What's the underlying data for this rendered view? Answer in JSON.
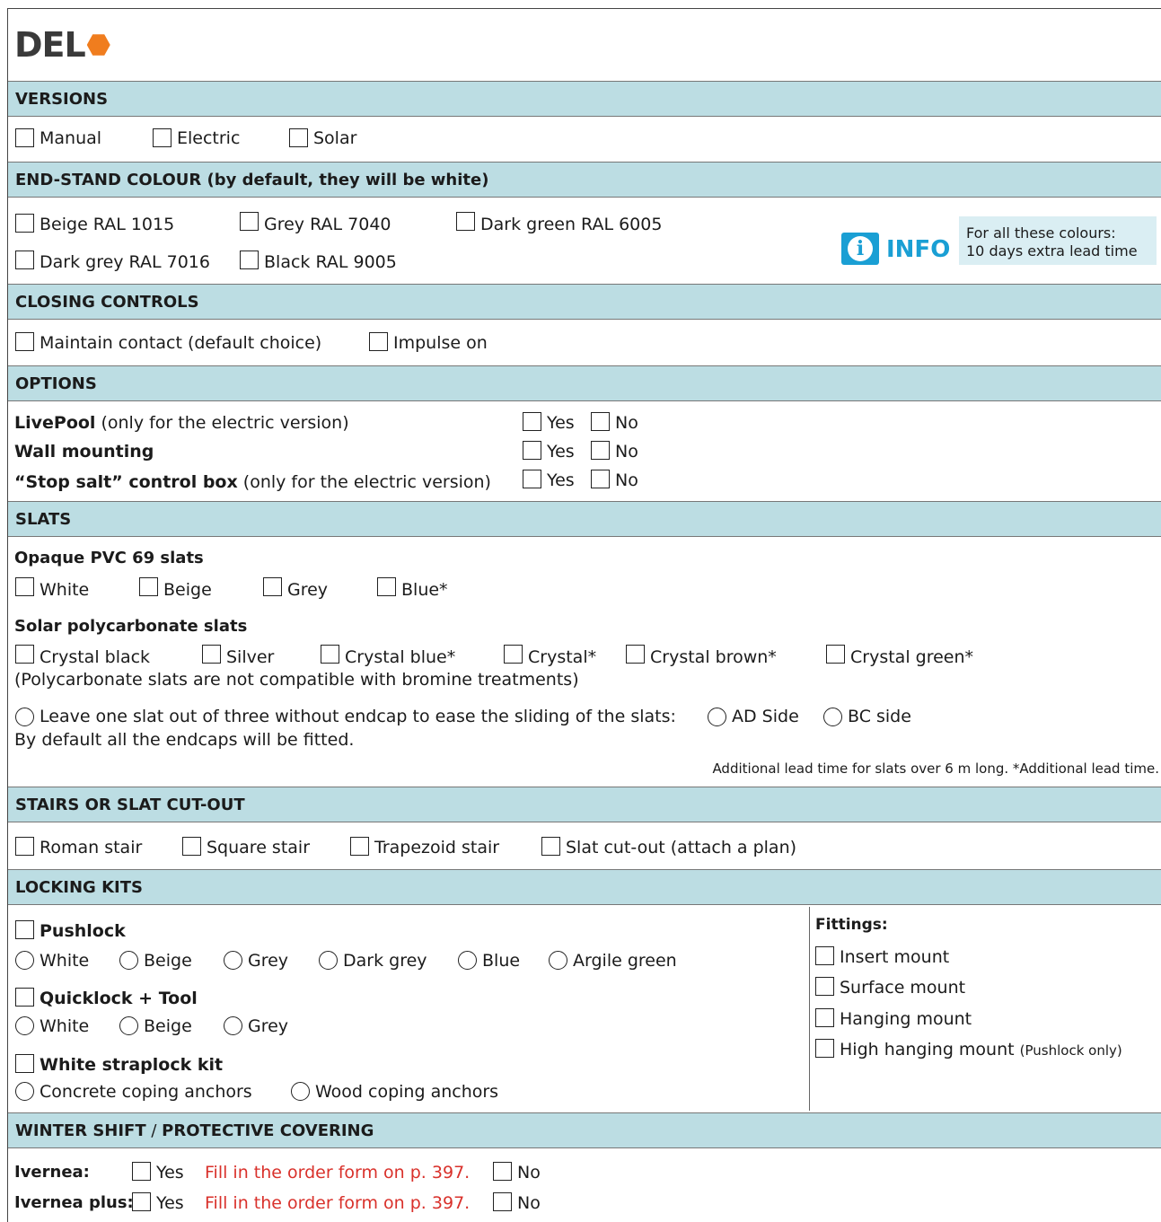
{
  "logo": {
    "text": "DEL"
  },
  "versions": {
    "title": "VERSIONS",
    "options": [
      "Manual",
      "Electric",
      "Solar"
    ]
  },
  "endstand": {
    "title": "END-STAND COLOUR (by default, they will be white)",
    "options": [
      "Beige RAL 1015",
      "Grey RAL 7040",
      "Dark green RAL 6005",
      "Dark grey RAL 7016",
      "Black RAL 9005"
    ],
    "info_word": "INFO",
    "info_line1": "For all these colours:",
    "info_line2": "10 days extra lead time"
  },
  "closing": {
    "title": "CLOSING CONTROLS",
    "options": [
      "Maintain contact (default choice)",
      "Impulse on"
    ]
  },
  "options_section": {
    "title": "OPTIONS",
    "rows": [
      {
        "label": "LivePool",
        "note": " (only for the electric version)"
      },
      {
        "label": "Wall mounting",
        "note": ""
      },
      {
        "label": "“Stop salt” control box",
        "note": " (only for the electric version)"
      }
    ],
    "yes": "Yes",
    "no": "No"
  },
  "slats": {
    "title": "SLATS",
    "opaque_title": "Opaque PVC 69 slats",
    "opaque_options": [
      "White",
      "Beige",
      "Grey",
      "Blue*"
    ],
    "solar_title": "Solar polycarbonate slats",
    "solar_options": [
      "Crystal black",
      "Silver",
      "Crystal blue*",
      "Crystal*",
      "Crystal brown*",
      "Crystal green*"
    ],
    "solar_note": "(Polycarbonate slats are not compatible with bromine treatments)",
    "leave_out": "Leave one slat out of three without endcap to ease the sliding of the slats:",
    "ad_side": "AD Side",
    "bc_side": "BC side",
    "default_note": "By default all the endcaps will be fitted.",
    "lead_note": "Additional lead time for slats over 6 m long. *Additional lead time."
  },
  "stairs": {
    "title": "STAIRS OR SLAT CUT-OUT",
    "options": [
      "Roman stair",
      "Square stair",
      "Trapezoid stair",
      "Slat cut-out (attach a plan)"
    ]
  },
  "locking": {
    "title": "LOCKING KITS",
    "pushlock": "Pushlock",
    "pushlock_colors": [
      "White",
      "Beige",
      "Grey",
      "Dark grey",
      "Blue",
      "Argile green"
    ],
    "quicklock": "Quicklock + Tool",
    "quicklock_colors": [
      "White",
      "Beige",
      "Grey"
    ],
    "straplock": "White straplock kit",
    "anchors": [
      "Concrete coping anchors",
      "Wood coping anchors"
    ],
    "fittings_title": "Fittings:",
    "fittings": [
      "Insert mount",
      "Surface mount",
      "Hanging mount",
      "High hanging mount"
    ],
    "fittings_note": "(Pushlock only)"
  },
  "winter": {
    "title_a": "WINTER SHIFT",
    "title_sep": " / ",
    "title_b": "PROTECTIVE COVERING",
    "rows": [
      {
        "label": "Ivernea:",
        "yes": "Yes",
        "fill": "Fill in the order form on p. 397.",
        "no": "No"
      },
      {
        "label": "Ivernea plus:",
        "yes": "Yes",
        "fill": "Fill in the order form on p. 397.",
        "no": "No"
      }
    ]
  },
  "colors": {
    "band": "#bcdde3",
    "info_blue": "#1a9fd4",
    "logo_orange": "#f07d1e",
    "note_red": "#d9312b"
  }
}
